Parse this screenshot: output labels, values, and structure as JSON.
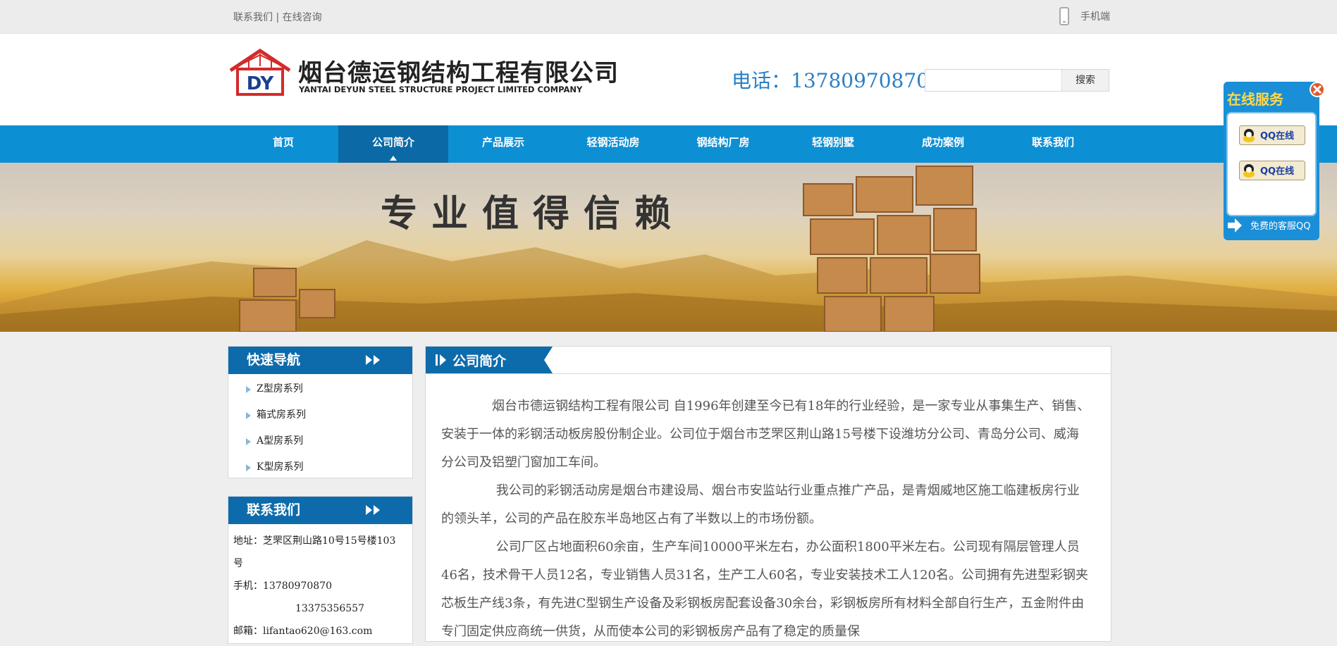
{
  "topbar": {
    "links_text": "联系我们 | 在线咨询",
    "mobile_label": "手机端"
  },
  "header": {
    "logo_letters": "DY",
    "company_name_cn": "烟台德运钢结构工程有限公司",
    "company_name_en": "YANTAI DEYUN STEEL STRUCTURE PROJECT LIMITED COMPANY",
    "tel_text": "电话：13780970870",
    "search_value": "",
    "search_button": "搜索"
  },
  "nav": {
    "items": [
      {
        "label": "首页"
      },
      {
        "label": "公司简介"
      },
      {
        "label": "产品展示"
      },
      {
        "label": "轻钢活动房"
      },
      {
        "label": "钢结构厂房"
      },
      {
        "label": "轻钢别墅"
      },
      {
        "label": "成功案例"
      },
      {
        "label": "联系我们"
      }
    ],
    "active_index": 1
  },
  "banner": {
    "slogan": "专业值得信赖"
  },
  "quick_nav": {
    "title": "快速导航",
    "items": [
      {
        "label": "Z型房系列"
      },
      {
        "label": "箱式房系列"
      },
      {
        "label": "A型房系列"
      },
      {
        "label": "K型房系列"
      }
    ]
  },
  "contact": {
    "title": "联系我们",
    "address_line1": "地址：芝罘区荆山路10号15号楼103",
    "address_line2": "号",
    "mobile_line1": "手机：13780970870",
    "mobile_line2": "13375356557",
    "email_line": "邮箱：lifantao620@163.com"
  },
  "main": {
    "title": "公司简介",
    "paragraphs": [
      "　　　　烟台市德运钢结构工程有限公司 自1996年创建至今已有18年的行业经验，是一家专业从事集生产、销售、安装于一体的彩钢活动板房股份制企业。公司位于烟台市芝罘区荆山路15号楼下设潍坊分公司、青岛分公司、威海分公司及铝塑门窗加工车间。",
      "　　　　 我公司的彩钢活动房是烟台市建设局、烟台市安监站行业重点推广产品，是青烟威地区施工临建板房行业的领头羊，公司的产品在胶东半岛地区占有了半数以上的市场份额。",
      "　　　　 公司厂区占地面积60余亩，生产车间10000平米左右，办公面积1800平米左右。公司现有隔层管理人员46名，技术骨干人员12名，专业销售人员31名，生产工人60名，专业安装技术工人120名。公司拥有先进型彩钢夹芯板生产线3条，有先进C型钢生产设备及彩钢板房配套设备30余台，彩钢板房所有材料全部自行生产，五金附件由专门固定供应商统一供货，从而使本公司的彩钢板房产品有了稳定的质量保"
    ]
  },
  "qq_panel": {
    "title": "在线服务",
    "btn1": "QQ在线",
    "btn2": "QQ在线",
    "footer": "免费的客服QQ"
  },
  "colors": {
    "nav_blue": "#0d8fd3",
    "nav_active": "#0b6aa6",
    "tel_blue": "#2a7fc6",
    "side_head": "#0d6bab"
  }
}
